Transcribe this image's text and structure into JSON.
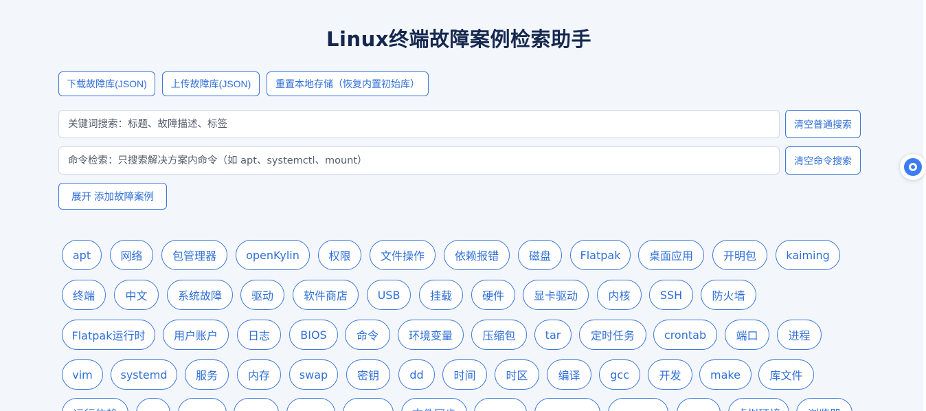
{
  "title": "Linux终端故障案例检索助手",
  "toolbar": {
    "download_label": "下载故障库(JSON)",
    "upload_label": "上传故障库(JSON)",
    "reset_label": "重置本地存储（恢复内置初始库）"
  },
  "search": {
    "keyword_placeholder": "关键词搜索：标题、故障描述、标签",
    "keyword_clear_label": "清空普通搜索",
    "command_placeholder": "命令检索：只搜索解决方案内命令（如 apt、systemctl、mount）",
    "command_clear_label": "清空命令搜索"
  },
  "add_case_label": "展开 添加故障案例",
  "tags": [
    [
      "apt",
      "网络",
      "包管理器",
      "openKylin",
      "权限",
      "文件操作",
      "依赖报错",
      "磁盘",
      "Flatpak",
      "桌面应用",
      "开明包",
      "kaiming"
    ],
    [
      "终端",
      "中文",
      "系统故障",
      "驱动",
      "软件商店",
      "USB",
      "挂载",
      "硬件",
      "显卡驱动",
      "内核",
      "SSH",
      "防火墙"
    ],
    [
      "Flatpak运行时",
      "用户账户",
      "日志",
      "BIOS",
      "命令",
      "环境变量",
      "压缩包",
      "tar",
      "定时任务",
      "crontab",
      "端口",
      "进程"
    ],
    [
      "vim",
      "systemd",
      "服务",
      "内存",
      "swap",
      "密钥",
      "dd",
      "时间",
      "时区",
      "编译",
      "gcc",
      "开发",
      "make",
      "库文件"
    ],
    [
      "运行依赖",
      "",
      "",
      "",
      "",
      "",
      "文件同步",
      "",
      "",
      "",
      "",
      "虚拟环境",
      "浏览器"
    ]
  ],
  "colors": {
    "accent": "#2f6fd6",
    "border": "#3b78d8",
    "background": "#f3f6fb",
    "title": "#16284f"
  },
  "float_icon": "assistant-bubble-icon"
}
